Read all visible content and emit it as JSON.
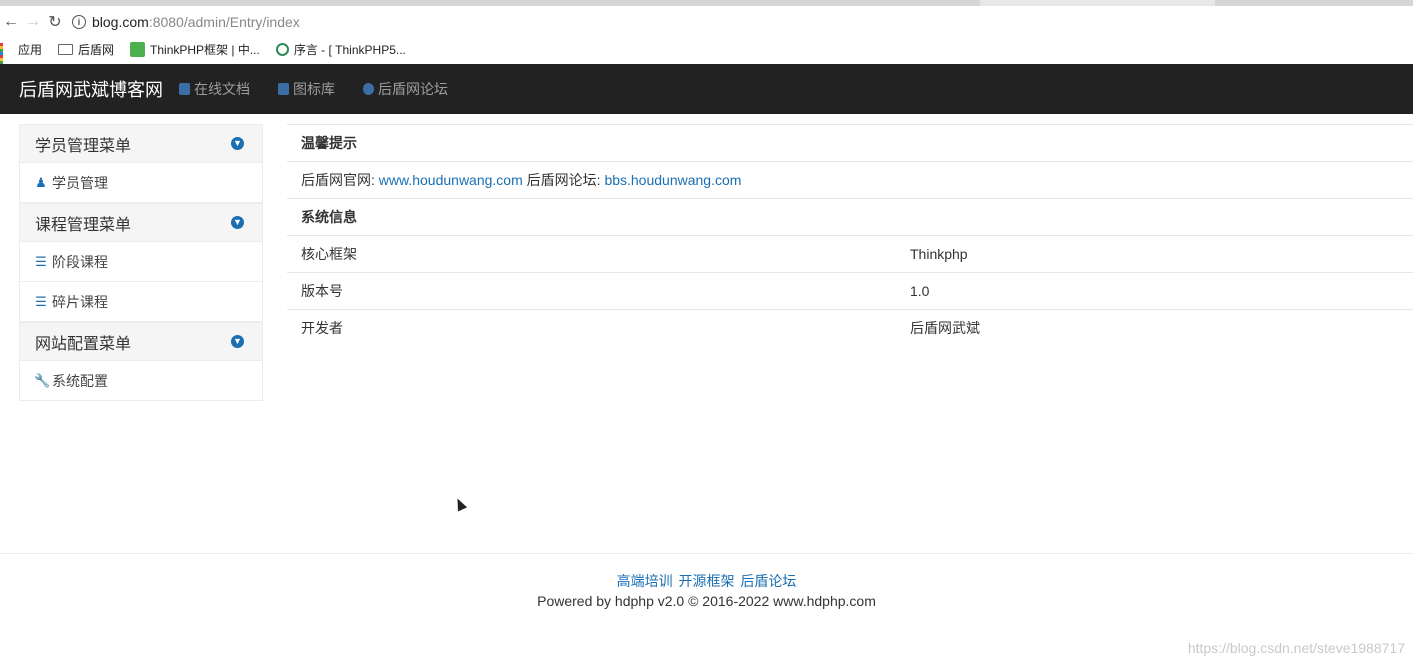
{
  "browser": {
    "url_host": "blog.com",
    "url_rest": ":8080/admin/Entry/index",
    "bookmarks": [
      {
        "label": "应用",
        "icon": "apps-grid-icon"
      },
      {
        "label": "后盾网",
        "icon": "folder-icon"
      },
      {
        "label": "ThinkPHP框架 | 中...",
        "icon": "thinkphp-icon"
      },
      {
        "label": "序言 - [ ThinkPHP5...",
        "icon": "leaf-icon"
      }
    ]
  },
  "navbar": {
    "brand": "后盾网武斌博客网",
    "links": [
      {
        "label": "在线文档",
        "icon": "doc-icon"
      },
      {
        "label": "图标库",
        "icon": "thumb-icon"
      },
      {
        "label": "后盾网论坛",
        "icon": "globe-icon"
      }
    ]
  },
  "sidebar": {
    "groups": [
      {
        "title": "学员管理菜单",
        "items": [
          {
            "label": "学员管理",
            "icon": "user-icon"
          }
        ]
      },
      {
        "title": "课程管理菜单",
        "items": [
          {
            "label": "阶段课程",
            "icon": "list-icon"
          },
          {
            "label": "碎片课程",
            "icon": "list-icon"
          }
        ]
      },
      {
        "title": "网站配置菜单",
        "items": [
          {
            "label": "系统配置",
            "icon": "wrench-icon"
          }
        ]
      }
    ]
  },
  "main": {
    "notice_title": "温馨提示",
    "official_label": "后盾网官网:",
    "official_link": "www.houdunwang.com",
    "forum_label": "后盾网论坛:",
    "forum_link": "bbs.houdunwang.com",
    "sysinfo_title": "系统信息",
    "rows": [
      {
        "key": "核心框架",
        "value": "Thinkphp"
      },
      {
        "key": "版本号",
        "value": "1.0"
      },
      {
        "key": "开发者",
        "value": "后盾网武斌"
      }
    ]
  },
  "footer": {
    "links": [
      "高端培训",
      "开源框架",
      "后盾论坛"
    ],
    "copyright": "Powered by hdphp v2.0 © 2016-2022 www.hdphp.com"
  },
  "watermark": "https://blog.csdn.net/steve1988717",
  "colors": {
    "navbar_bg": "#222222",
    "accent": "#1a6fb3"
  }
}
